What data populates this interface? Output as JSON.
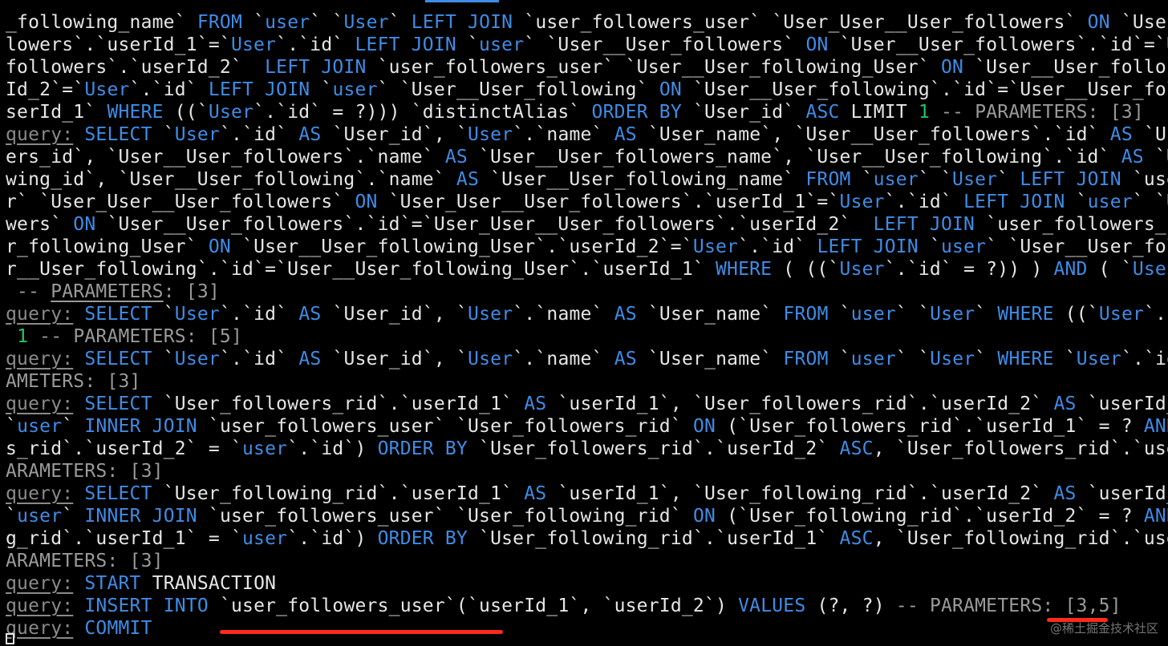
{
  "terminal": {
    "lines": [
      [
        [
          "t",
          "_following_name` "
        ],
        [
          "k",
          "FROM"
        ],
        [
          "t",
          " `"
        ],
        [
          "k",
          "user"
        ],
        [
          "t",
          "` `"
        ],
        [
          "k",
          "User"
        ],
        [
          "t",
          "` "
        ],
        [
          "k",
          "LEFT JOIN"
        ],
        [
          "t",
          " `user_followers_user` `User_User__User_followers` "
        ],
        [
          "k",
          "ON"
        ],
        [
          "t",
          " `User"
        ]
      ],
      [
        [
          "t",
          "lowers`.`userId_1`=`"
        ],
        [
          "k",
          "User"
        ],
        [
          "t",
          "`.`id` "
        ],
        [
          "k",
          "LEFT JOIN"
        ],
        [
          "t",
          " `"
        ],
        [
          "k",
          "user"
        ],
        [
          "t",
          "` `User__User_followers` "
        ],
        [
          "k",
          "ON"
        ],
        [
          "t",
          " `User__User_followers`.`id`=`U"
        ]
      ],
      [
        [
          "t",
          "followers`.`userId_2`  "
        ],
        [
          "k",
          "LEFT JOIN"
        ],
        [
          "t",
          " `user_followers_user` `User__User_following_User` "
        ],
        [
          "k",
          "ON"
        ],
        [
          "t",
          " `User__User_follo"
        ]
      ],
      [
        [
          "t",
          "Id_2`=`"
        ],
        [
          "k",
          "User"
        ],
        [
          "t",
          "`.`id` "
        ],
        [
          "k",
          "LEFT JOIN"
        ],
        [
          "t",
          " `"
        ],
        [
          "k",
          "user"
        ],
        [
          "t",
          "` `User__User_following` "
        ],
        [
          "k",
          "ON"
        ],
        [
          "t",
          " `User__User_following`.`id`=`User__User_fol"
        ]
      ],
      [
        [
          "t",
          "serId_1` "
        ],
        [
          "k",
          "WHERE"
        ],
        [
          "t",
          " ((`"
        ],
        [
          "k",
          "User"
        ],
        [
          "t",
          "`.`id` = ?))) `distinctAlias` "
        ],
        [
          "k",
          "ORDER BY"
        ],
        [
          "t",
          " `User_id` "
        ],
        [
          "k",
          "ASC"
        ],
        [
          "t",
          " LIMIT "
        ],
        [
          "n",
          "1"
        ],
        [
          "d",
          " -- PARAMETERS: [3]"
        ]
      ],
      [
        [
          "p",
          "query:"
        ],
        [
          "t",
          " "
        ],
        [
          "k",
          "SELECT"
        ],
        [
          "t",
          " `"
        ],
        [
          "k",
          "User"
        ],
        [
          "t",
          "`.`id` "
        ],
        [
          "k",
          "AS"
        ],
        [
          "t",
          " `User_id`, `"
        ],
        [
          "k",
          "User"
        ],
        [
          "t",
          "`.`name` "
        ],
        [
          "k",
          "AS"
        ],
        [
          "t",
          " `User_name`, `User__User_followers`.`id` "
        ],
        [
          "k",
          "AS"
        ],
        [
          "t",
          " `Us"
        ]
      ],
      [
        [
          "t",
          "ers_id`, `User__User_followers`.`name` "
        ],
        [
          "k",
          "AS"
        ],
        [
          "t",
          " `User__User_followers_name`, `User__User_following`.`id` "
        ],
        [
          "k",
          "AS"
        ],
        [
          "t",
          " `Use"
        ]
      ],
      [
        [
          "t",
          "wing_id`, `User__User_following`.`name` "
        ],
        [
          "k",
          "AS"
        ],
        [
          "t",
          " `User__User_following_name` "
        ],
        [
          "k",
          "FROM"
        ],
        [
          "t",
          " `"
        ],
        [
          "k",
          "user"
        ],
        [
          "t",
          "` `"
        ],
        [
          "k",
          "User"
        ],
        [
          "t",
          "` "
        ],
        [
          "k",
          "LEFT JOIN"
        ],
        [
          "t",
          " `use"
        ]
      ],
      [
        [
          "t",
          "r` `User_User__User_followers` "
        ],
        [
          "k",
          "ON"
        ],
        [
          "t",
          " `User_User__User_followers`.`userId_1`=`"
        ],
        [
          "k",
          "User"
        ],
        [
          "t",
          "`.`id` "
        ],
        [
          "k",
          "LEFT JOIN"
        ],
        [
          "t",
          " `"
        ],
        [
          "k",
          "user"
        ],
        [
          "t",
          "` `U"
        ]
      ],
      [
        [
          "t",
          "wers` "
        ],
        [
          "k",
          "ON"
        ],
        [
          "t",
          " `User__User_followers`.`id`=`User_User__User_followers`.`userId_2`  "
        ],
        [
          "k",
          "LEFT JOIN"
        ],
        [
          "t",
          " `user_followers_u"
        ]
      ],
      [
        [
          "t",
          "r_following_User` "
        ],
        [
          "k",
          "ON"
        ],
        [
          "t",
          " `User__User_following_User`.`userId_2`=`"
        ],
        [
          "k",
          "User"
        ],
        [
          "t",
          "`.`id` "
        ],
        [
          "k",
          "LEFT JOIN"
        ],
        [
          "t",
          " `"
        ],
        [
          "k",
          "user"
        ],
        [
          "t",
          "` `User__User_fol"
        ]
      ],
      [
        [
          "t",
          "r__User_following`.`id`=`User__User_following_User`.`userId_1` "
        ],
        [
          "k",
          "WHERE"
        ],
        [
          "t",
          " ( ((`"
        ],
        [
          "k",
          "User"
        ],
        [
          "t",
          "`.`id` = ?)) ) "
        ],
        [
          "k",
          "AND"
        ],
        [
          "t",
          " ( `"
        ],
        [
          "k",
          "User"
        ]
      ],
      [
        [
          "d",
          " -- "
        ],
        [
          "du",
          "PARAMETERS"
        ],
        [
          "d",
          ": [3]"
        ]
      ],
      [
        [
          "p",
          "query:"
        ],
        [
          "t",
          " "
        ],
        [
          "k",
          "SELECT"
        ],
        [
          "t",
          " `"
        ],
        [
          "k",
          "User"
        ],
        [
          "t",
          "`.`id` "
        ],
        [
          "k",
          "AS"
        ],
        [
          "t",
          " `User_id`, `"
        ],
        [
          "k",
          "User"
        ],
        [
          "t",
          "`.`name` "
        ],
        [
          "k",
          "AS"
        ],
        [
          "t",
          " `User_name` "
        ],
        [
          "k",
          "FROM"
        ],
        [
          "t",
          " `"
        ],
        [
          "k",
          "user"
        ],
        [
          "t",
          "` `"
        ],
        [
          "k",
          "User"
        ],
        [
          "t",
          "` "
        ],
        [
          "k",
          "WHERE"
        ],
        [
          "t",
          " ((`"
        ],
        [
          "k",
          "User"
        ],
        [
          "t",
          "`.`"
        ]
      ],
      [
        [
          "t",
          " "
        ],
        [
          "n",
          "1"
        ],
        [
          "d",
          " -- PARAMETERS: [5]"
        ]
      ],
      [
        [
          "p",
          "query:"
        ],
        [
          "t",
          " "
        ],
        [
          "k",
          "SELECT"
        ],
        [
          "t",
          " `"
        ],
        [
          "k",
          "User"
        ],
        [
          "t",
          "`.`id` "
        ],
        [
          "k",
          "AS"
        ],
        [
          "t",
          " `User_id`, `"
        ],
        [
          "k",
          "User"
        ],
        [
          "t",
          "`.`name` "
        ],
        [
          "k",
          "AS"
        ],
        [
          "t",
          " `User_name` "
        ],
        [
          "k",
          "FROM"
        ],
        [
          "t",
          " `"
        ],
        [
          "k",
          "user"
        ],
        [
          "t",
          "` `"
        ],
        [
          "k",
          "User"
        ],
        [
          "t",
          "` "
        ],
        [
          "k",
          "WHERE"
        ],
        [
          "t",
          " `"
        ],
        [
          "k",
          "User"
        ],
        [
          "t",
          "`.`id"
        ]
      ],
      [
        [
          "d",
          "AMETERS: [3]"
        ]
      ],
      [
        [
          "p",
          "query:"
        ],
        [
          "t",
          " "
        ],
        [
          "k",
          "SELECT"
        ],
        [
          "t",
          " `User_followers_rid`.`userId_1` "
        ],
        [
          "k",
          "AS"
        ],
        [
          "t",
          " `userId_1`, `User_followers_rid`.`userId_2` "
        ],
        [
          "k",
          "AS"
        ],
        [
          "t",
          " `userId_"
        ]
      ],
      [
        [
          "t",
          "`"
        ],
        [
          "k",
          "user"
        ],
        [
          "t",
          "` "
        ],
        [
          "k",
          "INNER JOIN"
        ],
        [
          "t",
          " `user_followers_user` `User_followers_rid` "
        ],
        [
          "k",
          "ON"
        ],
        [
          "t",
          " (`User_followers_rid`.`userId_1` = ? "
        ],
        [
          "k",
          "AND"
        ]
      ],
      [
        [
          "t",
          "s_rid`.`userId_2` = `"
        ],
        [
          "k",
          "user"
        ],
        [
          "t",
          "`.`id`) "
        ],
        [
          "k",
          "ORDER BY"
        ],
        [
          "t",
          " `User_followers_rid`.`userId_2` "
        ],
        [
          "k",
          "ASC"
        ],
        [
          "t",
          ", `User_followers_rid`.`use"
        ]
      ],
      [
        [
          "d",
          "ARAMETERS: [3]"
        ]
      ],
      [
        [
          "p",
          "query:"
        ],
        [
          "t",
          " "
        ],
        [
          "k",
          "SELECT"
        ],
        [
          "t",
          " `User_following_rid`.`userId_1` "
        ],
        [
          "k",
          "AS"
        ],
        [
          "t",
          " `userId_1`, `User_following_rid`.`userId_2` "
        ],
        [
          "k",
          "AS"
        ],
        [
          "t",
          " `userId_"
        ]
      ],
      [
        [
          "t",
          "`"
        ],
        [
          "k",
          "user"
        ],
        [
          "t",
          "` "
        ],
        [
          "k",
          "INNER JOIN"
        ],
        [
          "t",
          " `user_followers_user` `User_following_rid` "
        ],
        [
          "k",
          "ON"
        ],
        [
          "t",
          " (`User_following_rid`.`userId_2` = ? "
        ],
        [
          "k",
          "AND"
        ]
      ],
      [
        [
          "t",
          "g_rid`.`userId_1` = `"
        ],
        [
          "k",
          "user"
        ],
        [
          "t",
          "`.`id`) "
        ],
        [
          "k",
          "ORDER BY"
        ],
        [
          "t",
          " `User_following_rid`.`userId_1` "
        ],
        [
          "k",
          "ASC"
        ],
        [
          "t",
          ", `User_following_rid`.`use"
        ]
      ],
      [
        [
          "d",
          "ARAMETERS: [3]"
        ]
      ],
      [
        [
          "p",
          "query:"
        ],
        [
          "t",
          " "
        ],
        [
          "k",
          "START"
        ],
        [
          "t",
          " TRANSACTION"
        ]
      ],
      [
        [
          "p",
          "query:"
        ],
        [
          "t",
          " "
        ],
        [
          "k",
          "INSERT INTO"
        ],
        [
          "t",
          " `user_followers_user`(`userId_1`, `userId_2`) "
        ],
        [
          "k",
          "VALUES"
        ],
        [
          "t",
          " (?, ?)"
        ],
        [
          "d",
          " -- PARAMETERS: [3,5]"
        ]
      ],
      [
        [
          "p",
          "query:"
        ],
        [
          "t",
          " "
        ],
        [
          "k",
          "COMMIT"
        ]
      ]
    ]
  },
  "watermark": "@稀土掘金技术社区",
  "colors": {
    "background": "#000000",
    "text": "#e6e6e6",
    "keyword": "#3f8ce6",
    "number": "#22c55e",
    "muted": "#9a9a9a",
    "annotation": "#ff2a1a"
  }
}
